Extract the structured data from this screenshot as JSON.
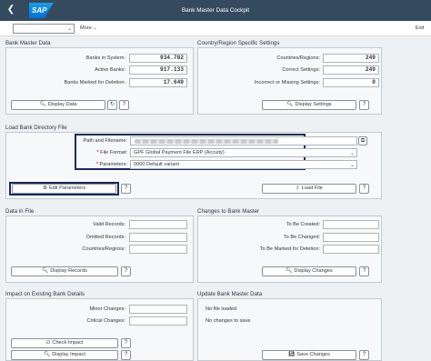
{
  "shell": {
    "back_icon": "back-icon",
    "logo": "SAP",
    "title": "Bank Master Data Cockpit"
  },
  "toolbar": {
    "more_label": "More",
    "exit_label": "Exit"
  },
  "bank_master_data": {
    "title": "Bank Master Data",
    "banks_in_system_label": "Banks in System:",
    "banks_in_system": "934.782",
    "active_banks_label": "Active Banks:",
    "active_banks": "917.133",
    "banks_marked_label": "Banks Marked for Deletion:",
    "banks_marked": "17.649",
    "display_button": "Display Data"
  },
  "country_settings": {
    "title": "Country/Region Specific Settings",
    "countries_label": "Countries/Regions:",
    "countries": "249",
    "correct_label": "Correct Settings:",
    "correct": "249",
    "incorrect_label": "Incorrect or Missing Settings:",
    "incorrect": "0",
    "display_button": "Display Settings"
  },
  "load_bank_directory": {
    "title": "Load Bank Directory File",
    "path_label": "Path and Filename:",
    "path_value": "",
    "file_format_label": "File Format:",
    "file_format_value": "GPF Global Payment File ERP (Accuity)",
    "parameters_label": "Parameters:",
    "parameters_value": "0000 Default variant",
    "edit_parameters_button": "Edit Parameters",
    "load_file_button": "Load File"
  },
  "data_in_file": {
    "title": "Data in File",
    "valid_label": "Valid Records:",
    "omitted_label": "Omitted Records:",
    "countries_label": "Countries/Regions:",
    "display_button": "Display Records"
  },
  "changes_to_bank_master": {
    "title": "Changes to Bank Master",
    "created_label": "To Be Created:",
    "changed_label": "To Be Changed:",
    "marked_label": "To Be Marked for Deletion:",
    "display_button": "Display Changes"
  },
  "impact": {
    "title": "Impact on Existing Bank Details",
    "minor_label": "Minor Changes:",
    "critical_label": "Critical Changes:",
    "check_button": "Check Impact",
    "display_button": "Display Impact"
  },
  "update": {
    "title": "Update Bank Master Data",
    "line1": "No file loaded",
    "line2": "No changes to save",
    "save_button": "Save Changes"
  }
}
